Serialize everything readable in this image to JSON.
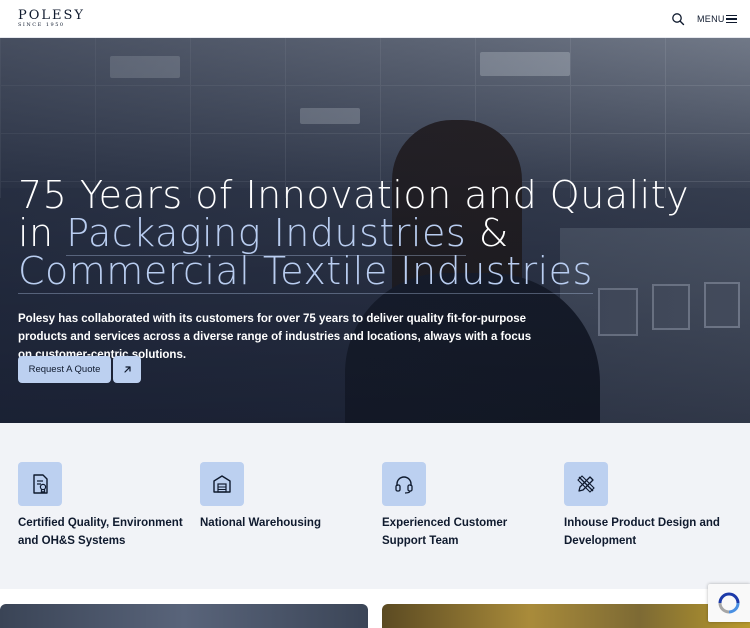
{
  "header": {
    "logo_text": "POLESY",
    "logo_tagline": "SINCE 1950",
    "menu_label": "MENU"
  },
  "hero": {
    "title_line1": "75 Years of Innovation and Quality",
    "title_line2_prefix": "in ",
    "title_line2_accent": "Packaging Industries",
    "title_line2_suffix": " &",
    "title_line3_accent": "Commercial Textile Industries",
    "description": "Polesy has collaborated with its customers for over 75 years to deliver quality fit-for-purpose products and services across a diverse range of industries and locations, always with a focus on customer-centric solutions.",
    "cta_label": "Request A Quote"
  },
  "features": [
    {
      "label": "Certified Quality, Environment and OH&S Systems",
      "icon": "certificate-icon"
    },
    {
      "label": "National Warehousing",
      "icon": "warehouse-icon"
    },
    {
      "label": "Experienced Customer Support Team",
      "icon": "headset-icon"
    },
    {
      "label": "Inhouse Product Design and Development",
      "icon": "design-tools-icon"
    }
  ],
  "colors": {
    "accent": "#bcd0f0",
    "navy": "#0f1a2e",
    "feature_bg": "#f1f3f7"
  }
}
